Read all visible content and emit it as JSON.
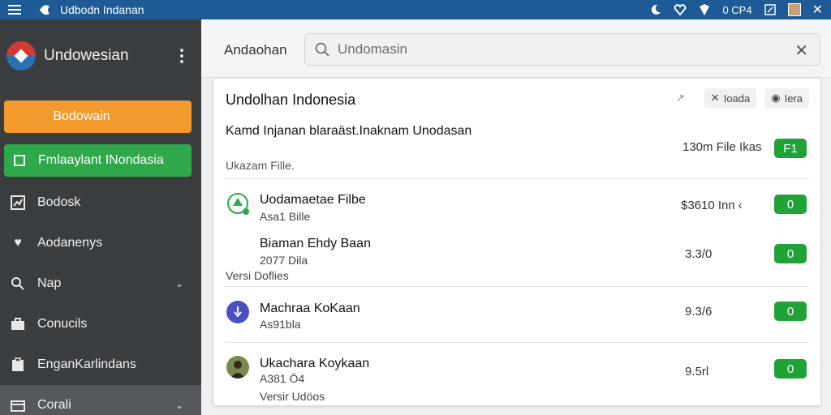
{
  "topbar": {
    "title": "Udbodn Indanan",
    "status_text": "0 CP4"
  },
  "sidebar": {
    "brand": "Undowesian",
    "primary_button": "Bodowain",
    "secondary_button": "Fmlaaylant INondasia",
    "items": [
      {
        "label": "Bodosk",
        "icon": "chart-icon"
      },
      {
        "label": "Aodanenys",
        "icon": "heart-icon"
      },
      {
        "label": "Nap",
        "icon": "search-icon"
      },
      {
        "label": "Conucils",
        "icon": "briefcase-icon"
      },
      {
        "label": "EnganKarlindans",
        "icon": "clipboard-icon"
      },
      {
        "label": "Corali",
        "icon": "folder-icon"
      }
    ]
  },
  "main": {
    "header_label": "Andaohan",
    "search_placeholder": "Undomasin"
  },
  "card": {
    "title": "Undolhan Indonesia",
    "tool_1": "Ioada",
    "tool_2": "Iera",
    "subtitle": "Kamd Injanan blaraäst.Inaknam Unodasan",
    "meta": "Ukazam Fille.",
    "size_text": "130m File Ikas",
    "size_badge": "F1",
    "rows": [
      {
        "title": "Uodamaetae Filbe",
        "sub": "Asa1 Bille",
        "value": "$3610 Inп ‹",
        "badge": "0"
      },
      {
        "title": "Biaman Ehdy Baan",
        "sub": "2077 Dila",
        "extra": "Versi Doflies",
        "value": "3.3/0",
        "badge": "0"
      },
      {
        "title": "Machraa KoKaan",
        "sub": "As91bla",
        "value": "9.3/6",
        "badge": "0"
      },
      {
        "title": "Ukachara Koykaan",
        "sub": "A381 Ö4",
        "extra": "Versir Udöos",
        "value": "9.5rl",
        "badge": "0"
      }
    ]
  },
  "colors": {
    "topbar": "#1d5a96",
    "sidebar": "#3a3d40",
    "accent_orange": "#f29a2e",
    "accent_green": "#2fa84a",
    "badge_green": "#1fa336"
  }
}
